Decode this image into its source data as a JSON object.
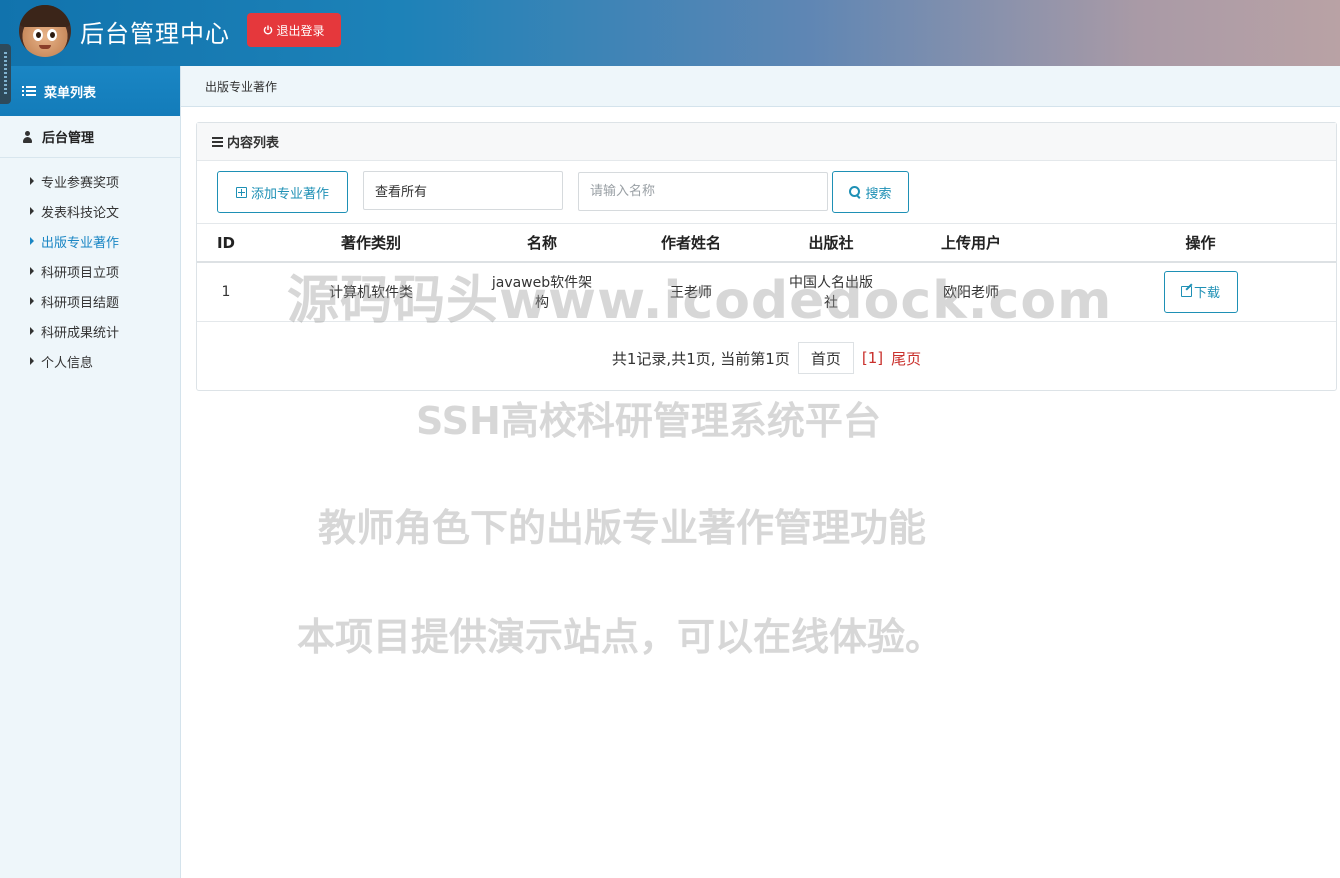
{
  "header": {
    "title": "后台管理中心",
    "logout_label": "退出登录",
    "background_gradient": [
      "#1173ad",
      "#b9a2a5"
    ],
    "logout_color": "#e5383c"
  },
  "sidebar": {
    "menu_title": "菜单列表",
    "group_title": "后台管理",
    "items": [
      {
        "label": "专业参赛奖项",
        "active": false
      },
      {
        "label": "发表科技论文",
        "active": false
      },
      {
        "label": "出版专业著作",
        "active": true
      },
      {
        "label": "科研项目立项",
        "active": false
      },
      {
        "label": "科研项目结题",
        "active": false
      },
      {
        "label": "科研成果统计",
        "active": false
      },
      {
        "label": "个人信息",
        "active": false
      }
    ],
    "accent_color": "#1a86c4"
  },
  "breadcrumb": "出版专业著作",
  "panel": {
    "title": "内容列表",
    "add_button": "添加专业著作",
    "select_value": "查看所有",
    "search_placeholder": "请输入名称",
    "search_button": "搜索"
  },
  "table": {
    "columns": [
      "ID",
      "著作类别",
      "名称",
      "作者姓名",
      "出版社",
      "上传用户",
      "操作"
    ],
    "rows": [
      {
        "id": "1",
        "category": "计算机软件类",
        "name": "javaweb软件架构",
        "author": "王老师",
        "publisher": "中国人名出版社",
        "uploader": "欧阳老师",
        "action": "下载"
      }
    ]
  },
  "pagination": {
    "summary": "共1记录,共1页, 当前第1页",
    "first": "首页",
    "current": "[1]",
    "last": "尾页"
  },
  "watermarks": {
    "line1": "源码码头www.icodedock.com",
    "line2": "SSH高校科研管理系统平台",
    "line3": "教师角色下的出版专业著作管理功能",
    "line4": "本项目提供演示站点，可以在线体验。"
  }
}
